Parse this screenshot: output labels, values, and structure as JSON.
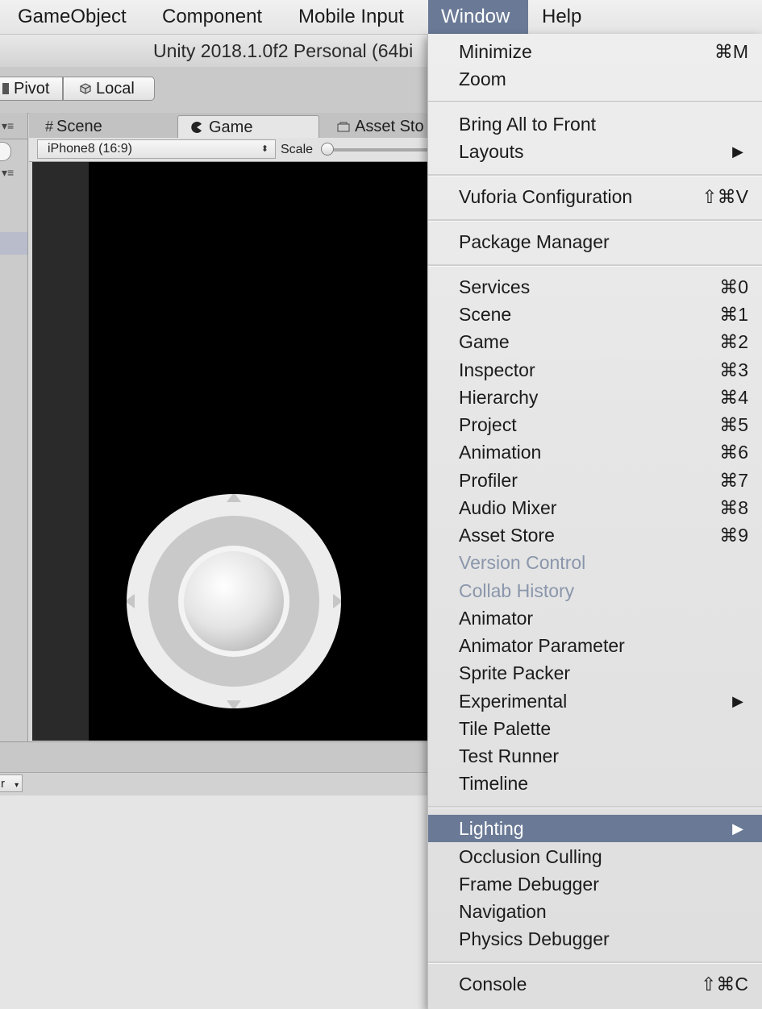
{
  "menubar": {
    "items": [
      {
        "label": "GameObject"
      },
      {
        "label": "Component"
      },
      {
        "label": "Mobile Input"
      },
      {
        "label": "Window"
      },
      {
        "label": "Help"
      }
    ]
  },
  "window": {
    "title": "Unity 2018.1.0f2 Personal (64bi"
  },
  "toolbar": {
    "pivot_label": "Pivot",
    "local_label": "Local"
  },
  "tabs": {
    "scene": "Scene",
    "game": "Game",
    "asset_store": "Asset Sto"
  },
  "game_toolbar": {
    "resolution": "iPhone8 (16:9)",
    "scale_label": "Scale"
  },
  "bottom": {
    "dropdown_label": "r"
  },
  "colors": {
    "accent": "#6a7a96",
    "disabled_text": "#8a96ab"
  },
  "window_menu": {
    "items": [
      {
        "label": "Minimize",
        "shortcut": "⌘M"
      },
      {
        "label": "Zoom",
        "shortcut": ""
      },
      {
        "label": "Bring All to Front",
        "shortcut": ""
      },
      {
        "label": "Layouts",
        "shortcut": "",
        "submenu": true
      },
      {
        "label": "Vuforia Configuration",
        "shortcut": "⇧⌘V"
      },
      {
        "label": "Package Manager",
        "shortcut": ""
      },
      {
        "label": "Services",
        "shortcut": "⌘0"
      },
      {
        "label": "Scene",
        "shortcut": "⌘1"
      },
      {
        "label": "Game",
        "shortcut": "⌘2"
      },
      {
        "label": "Inspector",
        "shortcut": "⌘3"
      },
      {
        "label": "Hierarchy",
        "shortcut": "⌘4"
      },
      {
        "label": "Project",
        "shortcut": "⌘5"
      },
      {
        "label": "Animation",
        "shortcut": "⌘6"
      },
      {
        "label": "Profiler",
        "shortcut": "⌘7"
      },
      {
        "label": "Audio Mixer",
        "shortcut": "⌘8"
      },
      {
        "label": "Asset Store",
        "shortcut": "⌘9"
      },
      {
        "label": "Version Control",
        "shortcut": "",
        "disabled": true
      },
      {
        "label": "Collab History",
        "shortcut": "",
        "disabled": true
      },
      {
        "label": "Animator",
        "shortcut": ""
      },
      {
        "label": "Animator Parameter",
        "shortcut": ""
      },
      {
        "label": "Sprite Packer",
        "shortcut": ""
      },
      {
        "label": "Experimental",
        "shortcut": "",
        "submenu": true
      },
      {
        "label": "Tile Palette",
        "shortcut": ""
      },
      {
        "label": "Test Runner",
        "shortcut": ""
      },
      {
        "label": "Timeline",
        "shortcut": ""
      },
      {
        "label": "Lighting",
        "shortcut": "",
        "submenu": true,
        "highlighted": true
      },
      {
        "label": "Occlusion Culling",
        "shortcut": ""
      },
      {
        "label": "Frame Debugger",
        "shortcut": ""
      },
      {
        "label": "Navigation",
        "shortcut": ""
      },
      {
        "label": "Physics Debugger",
        "shortcut": ""
      },
      {
        "label": "Console",
        "shortcut": "⇧⌘C"
      }
    ]
  }
}
